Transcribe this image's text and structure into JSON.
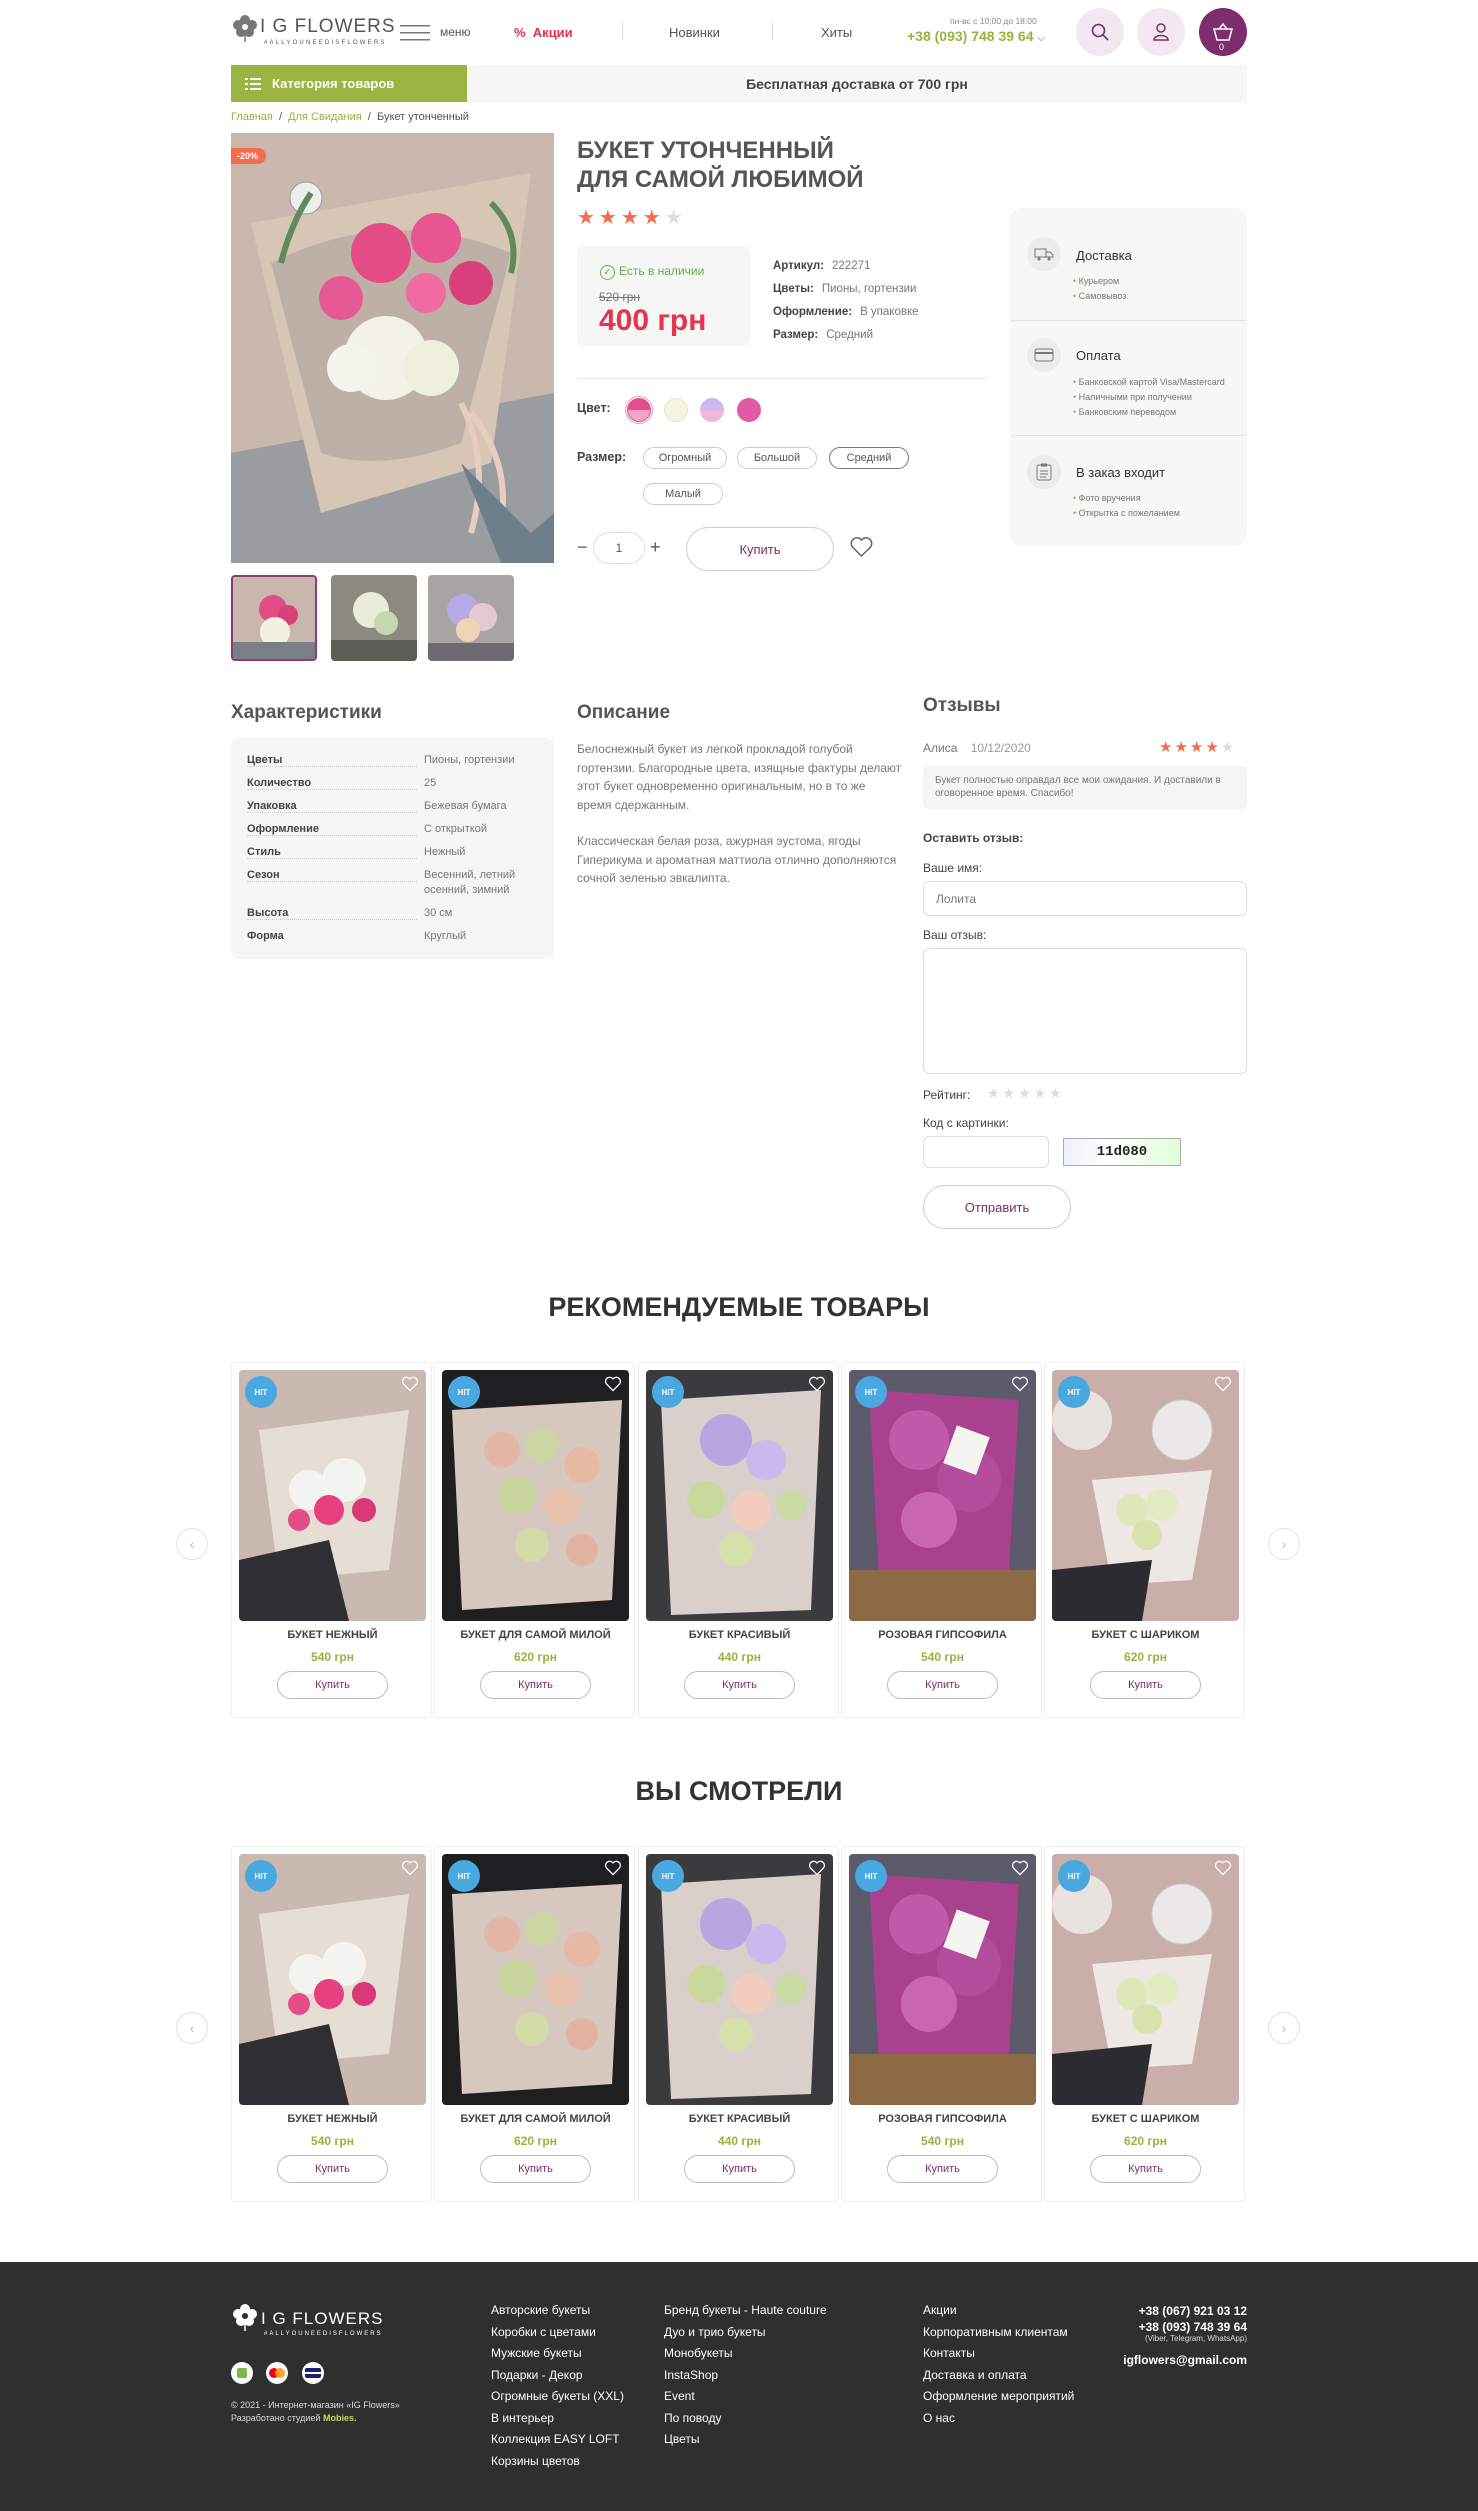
{
  "header": {
    "logo_text": "I G FLOWERS",
    "logo_sub": "#ALLYOUNEEDISFLOWERS",
    "menu_label": "меню",
    "nav": [
      "Акции",
      "Новинки",
      "Хиты"
    ],
    "hours": "пн-вс с 10:00 до 18:00",
    "phone": "+38 (093) 748 39 64",
    "cart_count": "0",
    "icons": [
      "search-icon",
      "user-icon",
      "basket-icon"
    ]
  },
  "category_button": "Категория товаров",
  "shipping_banner": "Бесплатная доставка от 700 грн",
  "breadcrumb": {
    "home": "Главная",
    "parent": "Для Свидания",
    "current": "Букет утонченный"
  },
  "product": {
    "discount": "-20%",
    "title_line1": "Букет утонченный",
    "title_line2": "для самой любимой",
    "rating": 4,
    "in_stock": "Есть в наличии",
    "old_price": "520 грн",
    "price": "400 грн",
    "specs": [
      {
        "k": "Артикул:",
        "v": "222271"
      },
      {
        "k": "Цветы:",
        "v": "Пионы, гортензии"
      },
      {
        "k": "Оформление:",
        "v": "В упаковке"
      },
      {
        "k": "Размер:",
        "v": "Средний"
      }
    ],
    "color_label": "Цвет:",
    "colors": [
      "#e54d8d",
      "#f4f6df",
      "#c9b9f2",
      "#e35aa4"
    ],
    "size_label": "Размер:",
    "sizes": [
      "Огромный",
      "Большой",
      "Средний",
      "Малый"
    ],
    "selected_size": "Средний",
    "qty": "1",
    "buy": "Купить"
  },
  "info": {
    "delivery": {
      "title": "Доставка",
      "items": [
        "Курьером",
        "Самовывоз"
      ]
    },
    "payment": {
      "title": "Оплата",
      "items": [
        "Банковской картой Visa/Mastercard",
        "Наличными при получении",
        "Банковским переводом"
      ]
    },
    "included": {
      "title": "В заказ входит",
      "items": [
        "Фото вручения",
        "Открытка с пожеланием"
      ]
    }
  },
  "characteristics": {
    "title": "Характеристики",
    "rows": [
      {
        "k": "Цветы",
        "v": "Пионы, гортензии"
      },
      {
        "k": "Количество",
        "v": "25"
      },
      {
        "k": "Упаковка",
        "v": "Бежевая бумага"
      },
      {
        "k": "Оформление",
        "v": "С открыткой"
      },
      {
        "k": "Стиль",
        "v": "Нежный"
      },
      {
        "k": "Сезон",
        "v": "Весенний, летний осенний, зимний"
      },
      {
        "k": "Высота",
        "v": "30 см"
      },
      {
        "k": "Форма",
        "v": "Круглый"
      }
    ]
  },
  "description": {
    "title": "Описание",
    "p1": "Белоснежный букет из легкой прокладой голубой гортензии. Благородные цвета, изящные фактуры делают этот букет одновременно оригинальным, но в то же время сдержанным.",
    "p2": "Классическая белая роза, ажурная эустома, ягоды Гиперикума и ароматная маттиола отлично дополняются сочной зеленью эвкалипта."
  },
  "reviews": {
    "title": "Отзывы",
    "author": "Алиса",
    "date": "10/12/2020",
    "rating": 4,
    "text": "Букет полностью оправдал все мои ожидания. И доставили в оговоренное время. Спасибо!",
    "leave_review": "Оставить отзыв:",
    "name_label": "Ваше имя:",
    "name_value": "Лолита",
    "review_label": "Ваш отзыв:",
    "rating_label": "Рейтинг:",
    "captcha_label": "Код с картинки:",
    "captcha_code": "11d080",
    "send": "Отправить"
  },
  "recommended": {
    "title": "РЕКОМЕНДУЕМЫЕ ТОВАРЫ",
    "items": [
      {
        "badge": "HIT",
        "name": "БУКЕТ НЕЖНЫЙ",
        "price": "540 грн",
        "buy": "Купить"
      },
      {
        "badge": "HIT",
        "name": "БУКЕТ ДЛЯ САМОЙ МИЛОЙ",
        "price": "620 грн",
        "buy": "Купить"
      },
      {
        "badge": "HIT",
        "name": "БУКЕТ КРАСИВЫЙ",
        "price": "440 грн",
        "buy": "Купить"
      },
      {
        "badge": "HIT",
        "name": "РОЗОВАЯ ГИПСОФИЛА",
        "price": "540 грн",
        "buy": "Купить"
      },
      {
        "badge": "HIT",
        "name": "БУКЕТ С ШАРИКОМ",
        "price": "620 грн",
        "buy": "Купить"
      }
    ]
  },
  "viewed": {
    "title": "ВЫ СМОТРЕЛИ",
    "items": [
      {
        "badge": "HIT",
        "name": "БУКЕТ НЕЖНЫЙ",
        "price": "540 грн",
        "buy": "Купить"
      },
      {
        "badge": "HIT",
        "name": "БУКЕТ ДЛЯ САМОЙ МИЛОЙ",
        "price": "620 грн",
        "buy": "Купить"
      },
      {
        "badge": "HIT",
        "name": "БУКЕТ КРАСИВЫЙ",
        "price": "440 грн",
        "buy": "Купить"
      },
      {
        "badge": "HIT",
        "name": "РОЗОВАЯ ГИПСОФИЛА",
        "price": "540 грн",
        "buy": "Купить"
      },
      {
        "badge": "HIT",
        "name": "БУКЕТ С ШАРИКОМ",
        "price": "620 грн",
        "buy": "Купить"
      }
    ]
  },
  "footer": {
    "col1": [
      "Авторские букеты",
      "Коробки с цветами",
      "Мужские букеты",
      "Подарки - Декор",
      "Огромные букеты (XXL)",
      "В интерьер",
      "Коллекция EASY LOFT",
      "Корзины цветов"
    ],
    "col2": [
      "Бренд букеты - Haute couture",
      "Дуо и трио букеты",
      "Монобукеты",
      "InstaShop",
      "Event",
      "По поводу",
      "Цветы"
    ],
    "col3": [
      "Акции",
      "Корпоративным клиентам",
      "Контакты",
      "Доставка и оплата",
      "Оформление мероприятий",
      "О нас"
    ],
    "phone1": "+38 (067) 921 03 12",
    "phone2": "+38 (093) 748 39 64",
    "messengers": "(Viber, Telegram, WhatsApp)",
    "email": "igflowers@gmail.com",
    "copyright": "© 2021 - Интернет-магазин «IG Flowers»",
    "dev_prefix": "Разработано студией",
    "dev_name": "Mobies."
  },
  "colors": {
    "accent_green": "#97b23e",
    "brand_purple": "#7d2c6c",
    "price_red": "#e5344e",
    "star": "#f26c4f",
    "hit_blue": "#4aa8e0"
  }
}
